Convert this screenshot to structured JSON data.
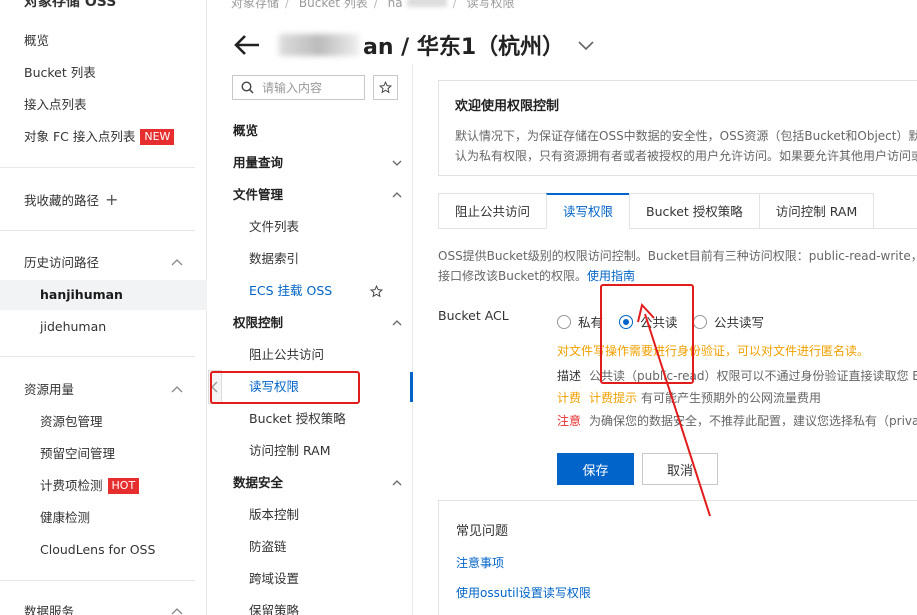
{
  "sidebar": {
    "title": "对象存储 OSS",
    "items": [
      {
        "label": "概览"
      },
      {
        "label": "Bucket 列表"
      },
      {
        "label": "接入点列表"
      },
      {
        "label": "对象 FC 接入点列表",
        "badge": "NEW"
      }
    ],
    "favorites": {
      "label": "我收藏的路径",
      "action": "+"
    },
    "history": {
      "label": "历史访问路径",
      "items": [
        {
          "label": "hanjihuman",
          "active": true
        },
        {
          "label": "jidehuman"
        }
      ]
    },
    "resources": {
      "label": "资源用量",
      "items": [
        {
          "label": "资源包管理"
        },
        {
          "label": "预留空间管理"
        },
        {
          "label": "计费项检测",
          "badge": "HOT"
        },
        {
          "label": "健康检测"
        },
        {
          "label": "CloudLens for OSS"
        }
      ]
    },
    "data_services": {
      "label": "数据服务"
    }
  },
  "breadcrumb": [
    "对象存储",
    "Bucket 列表",
    "ha",
    "读写权限"
  ],
  "header": {
    "title_suffix": "an / 华东1（杭州）"
  },
  "midnav": {
    "search_placeholder": "请输入内容",
    "items": [
      {
        "label": "概览",
        "type": "group"
      },
      {
        "label": "用量查询",
        "type": "group",
        "expanded": false
      },
      {
        "label": "文件管理",
        "type": "group",
        "expanded": true
      },
      {
        "label": "文件列表",
        "type": "sub"
      },
      {
        "label": "数据索引",
        "type": "sub"
      },
      {
        "label": "ECS 挂载 OSS",
        "type": "sub-link"
      },
      {
        "label": "权限控制",
        "type": "group",
        "expanded": true
      },
      {
        "label": "阻止公共访问",
        "type": "sub"
      },
      {
        "label": "读写权限",
        "type": "sub-active"
      },
      {
        "label": "Bucket 授权策略",
        "type": "sub"
      },
      {
        "label": "访问控制 RAM",
        "type": "sub"
      },
      {
        "label": "数据安全",
        "type": "group",
        "expanded": true
      },
      {
        "label": "版本控制",
        "type": "sub"
      },
      {
        "label": "防盗链",
        "type": "sub"
      },
      {
        "label": "跨域设置",
        "type": "sub"
      },
      {
        "label": "保留策略",
        "type": "sub"
      }
    ]
  },
  "welcome": {
    "title": "欢迎使用权限控制",
    "text": "默认情况下，为保证存储在OSS中数据的安全性，OSS资源（包括Bucket和Object）默认为私有权限，只有资源拥有者或者被授权的用户允许访问。如果要允许其他用户访问或使用您的OSS资源，您可以通过多种方式为其他用户授予权限。"
  },
  "tabs": [
    {
      "label": "阻止公共访问"
    },
    {
      "label": "读写权限",
      "active": true
    },
    {
      "label": "Bucket 授权策略"
    },
    {
      "label": "访问控制 RAM"
    }
  ],
  "intro": {
    "line1": "OSS提供Bucket级别的权限访问控制。Bucket目前有三种访问权限：public-read-write，public-read和private。您可以在创建Bucket时设置，也可以通过",
    "line2": "接口修改该Bucket的权限。",
    "link": "使用指南"
  },
  "acl": {
    "label": "Bucket ACL",
    "options": [
      {
        "label": "私有",
        "checked": false
      },
      {
        "label": "公共读",
        "checked": true
      },
      {
        "label": "公共读写",
        "checked": false
      }
    ],
    "warning": "对文件写操作需要进行身份验证，可以对文件进行匿名读。",
    "desc_label": "描述",
    "desc": "公共读（public-read）权限可以不通过身份验证直接读取您 Bucket 中的数据。",
    "billing_label": "计费",
    "billing_hl": "计费提示",
    "billing": "有可能产生预期外的公网流量费用",
    "note_label": "注意",
    "note": "为确保您的数据安全，不推荐此配置，建议您选择私有（private）。"
  },
  "buttons": {
    "save": "保存",
    "cancel": "取消"
  },
  "faq": {
    "title": "常见问题",
    "links": [
      "注意事项",
      "使用ossutil设置读写权限"
    ]
  },
  "colors": {
    "accent": "#0064c8",
    "warning": "#f0a000",
    "danger": "#e62e2e",
    "annotation": "#e21b1b"
  }
}
